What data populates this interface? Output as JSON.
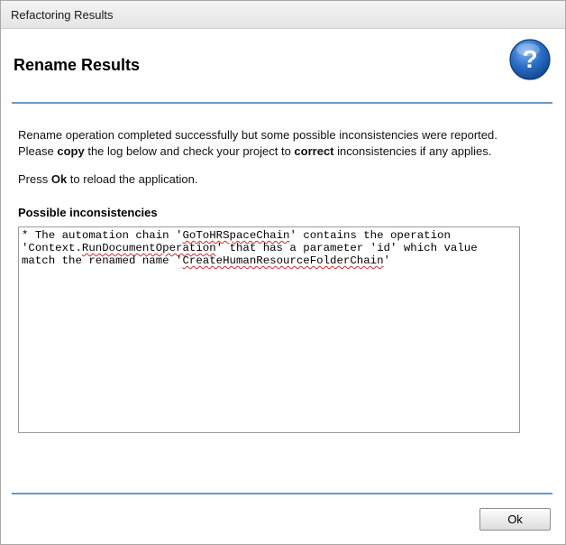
{
  "window": {
    "title": "Refactoring Results"
  },
  "header": {
    "heading": "Rename Results",
    "help_icon_glyph": "?",
    "help_icon": "help-question-icon",
    "accent_color": "#2c6fc6"
  },
  "messages": {
    "line1": "Rename operation completed successfully but some possible inconsistencies were reported.",
    "line2_pre": "Please ",
    "line2_copy": "copy",
    "line2_mid": " the log below and check your project to ",
    "line2_correct": "correct",
    "line2_post": " inconsistencies if any applies.",
    "line3_pre": "Press ",
    "line3_ok": "Ok",
    "line3_post": " to reload the application."
  },
  "inconsistencies": {
    "label": "Possible inconsistencies",
    "log": {
      "l1_pre": "* The automation chain '",
      "l1_chain": "GoToHRSpaceChain",
      "l1_post": "' contains the operation",
      "l2_pre": "'Context.",
      "l2_op": "RunDocumentOperation",
      "l2_post": "' that has a parameter 'id' which value",
      "l3_pre": "match the renamed name '",
      "l3_name": "CreateHumanResourceFolderChain",
      "l3_post": "'"
    }
  },
  "footer": {
    "ok_label": "Ok"
  }
}
